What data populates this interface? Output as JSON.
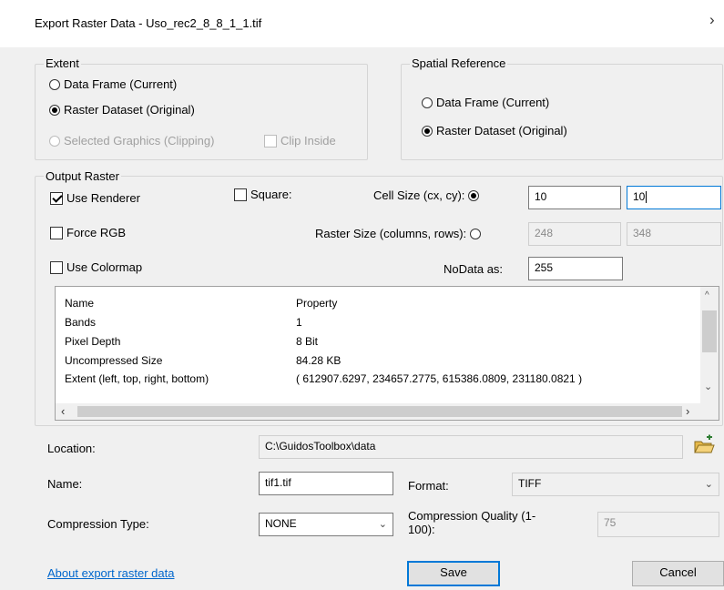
{
  "window": {
    "title": "Export Raster Data - Uso_rec2_8_8_1_1.tif",
    "close_glyph": "›"
  },
  "extent": {
    "legend": "Extent",
    "options": [
      {
        "label": "Data Frame (Current)",
        "checked": false,
        "enabled": true
      },
      {
        "label": "Raster Dataset (Original)",
        "checked": true,
        "enabled": true
      },
      {
        "label": "Selected Graphics (Clipping)",
        "checked": false,
        "enabled": false
      }
    ],
    "clip_inside": {
      "label": "Clip Inside",
      "checked": false,
      "enabled": false
    }
  },
  "spatial_reference": {
    "legend": "Spatial Reference",
    "options": [
      {
        "label": "Data Frame (Current)",
        "checked": false
      },
      {
        "label": "Raster Dataset (Original)",
        "checked": true
      }
    ]
  },
  "output_raster": {
    "legend": "Output Raster",
    "use_renderer": {
      "label": "Use Renderer",
      "checked": true
    },
    "force_rgb": {
      "label": "Force RGB",
      "checked": false
    },
    "use_colormap": {
      "label": "Use Colormap",
      "checked": false
    },
    "square": {
      "label": "Square:",
      "checked": false
    },
    "cell_size": {
      "label": "Cell Size (cx, cy):",
      "selected": true,
      "cx": "10",
      "cy": "10"
    },
    "raster_size": {
      "label": "Raster Size (columns, rows):",
      "selected": false,
      "columns": "248",
      "rows": "348"
    },
    "nodata": {
      "label": "NoData as:",
      "value": "255"
    },
    "properties": {
      "headers": [
        "Name",
        "Property"
      ],
      "rows": [
        {
          "name": "Bands",
          "value": "1"
        },
        {
          "name": "Pixel Depth",
          "value": "8 Bit"
        },
        {
          "name": "Uncompressed Size",
          "value": "84.28 KB"
        },
        {
          "name": "Extent (left, top, right, bottom)",
          "value": "( 612907.6297, 234657.2775, 615386.0809, 231180.0821 )"
        }
      ]
    }
  },
  "location": {
    "label": "Location:",
    "value": "C:\\GuidosToolbox\\data"
  },
  "name": {
    "label": "Name:",
    "value": "tif1.tif"
  },
  "format": {
    "label": "Format:",
    "value": "TIFF"
  },
  "compression_type": {
    "label": "Compression Type:",
    "value": "NONE"
  },
  "compression_quality": {
    "label": "Compression Quality (1-100):",
    "value": "75"
  },
  "footer": {
    "about_link": "About export raster data",
    "save_label": "Save",
    "cancel_label": "Cancel"
  },
  "colors": {
    "accent": "#0078d7",
    "link": "#0066cc",
    "background": "#f0f0f0"
  }
}
